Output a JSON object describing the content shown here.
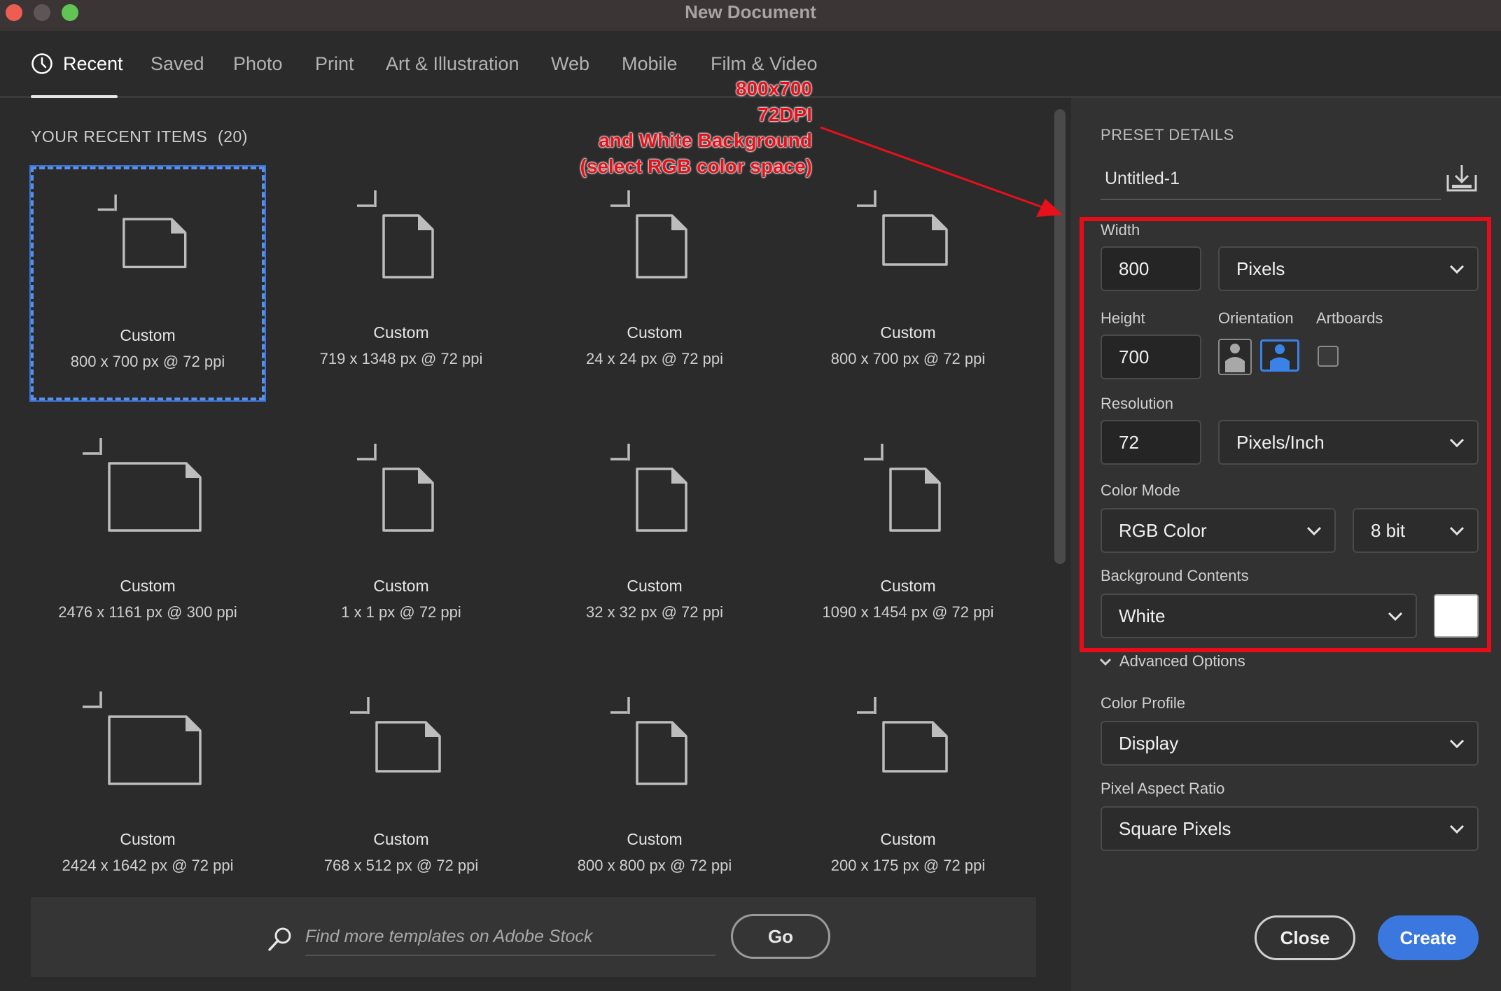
{
  "window": {
    "title": "New Document"
  },
  "tabs": [
    {
      "label": "Recent"
    },
    {
      "label": "Saved"
    },
    {
      "label": "Photo"
    },
    {
      "label": "Print"
    },
    {
      "label": "Art & Illustration"
    },
    {
      "label": "Web"
    },
    {
      "label": "Mobile"
    },
    {
      "label": "Film & Video"
    }
  ],
  "recent": {
    "title": "YOUR RECENT ITEMS",
    "count": "(20)",
    "items": [
      {
        "name": "Custom",
        "size": "800 x 700 px @ 72 ppi"
      },
      {
        "name": "Custom",
        "size": "719 x 1348 px @ 72 ppi"
      },
      {
        "name": "Custom",
        "size": "24 x 24 px @ 72 ppi"
      },
      {
        "name": "Custom",
        "size": "800 x 700 px @ 72 ppi"
      },
      {
        "name": "Custom",
        "size": "2476 x 1161 px @ 300 ppi"
      },
      {
        "name": "Custom",
        "size": "1 x 1 px @ 72 ppi"
      },
      {
        "name": "Custom",
        "size": "32 x 32 px @ 72 ppi"
      },
      {
        "name": "Custom",
        "size": "1090 x 1454 px @ 72 ppi"
      },
      {
        "name": "Custom",
        "size": "2424 x 1642 px @ 72 ppi"
      },
      {
        "name": "Custom",
        "size": "768 x 512 px @ 72 ppi"
      },
      {
        "name": "Custom",
        "size": "800 x 800 px @ 72 ppi"
      },
      {
        "name": "Custom",
        "size": "200 x 175 px @ 72 ppi"
      }
    ]
  },
  "search": {
    "placeholder": "Find more templates on Adobe Stock",
    "go_label": "Go"
  },
  "annotation": {
    "lines": [
      "800x700",
      "72DPI",
      "and White Background",
      "(select RGB color space)"
    ],
    "color": "#e8101a"
  },
  "preset": {
    "header": "PRESET DETAILS",
    "name": "Untitled-1",
    "width_label": "Width",
    "width_value": "800",
    "width_unit": "Pixels",
    "height_label": "Height",
    "height_value": "700",
    "orientation_label": "Orientation",
    "artboards_label": "Artboards",
    "resolution_label": "Resolution",
    "resolution_value": "72",
    "resolution_unit": "Pixels/Inch",
    "color_mode_label": "Color Mode",
    "color_mode": "RGB Color",
    "bit_depth": "8 bit",
    "background_label": "Background Contents",
    "background": "White",
    "background_swatch": "#ffffff",
    "advanced_label": "Advanced Options",
    "color_profile_label": "Color Profile",
    "color_profile": "Display",
    "pixel_aspect_label": "Pixel Aspect Ratio",
    "pixel_aspect": "Square Pixels",
    "close_label": "Close",
    "create_label": "Create"
  },
  "colors": {
    "accent": "#3a78e0",
    "highlight_box": "#e60d18"
  }
}
